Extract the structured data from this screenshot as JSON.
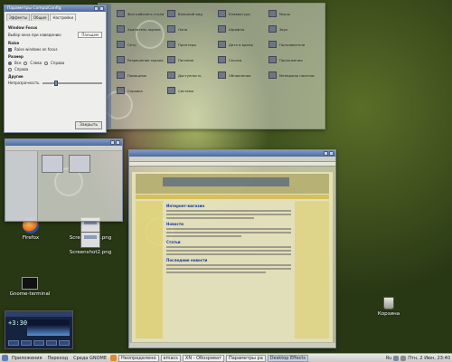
{
  "desktop_icons": {
    "firefox": "Firefox",
    "screenshot1": "Screenshot1.png",
    "screenshot2": "Screenshot2.png",
    "terminal": "Gnome-terminal",
    "trash": "Корзина"
  },
  "prefs_dialog": {
    "title": "Параметры CompizConfig",
    "tabs": [
      "Эффекты",
      "Общие",
      "Настройки"
    ],
    "section_window": "Window Focus",
    "focus_label": "Выбор окна при наведении:",
    "focus_value": "Пальцем",
    "section_raise": "Raise",
    "raise_opt": "Raise windows on focus",
    "section_size": "Размер",
    "size_opts": [
      "Все",
      "Слева",
      "Справа",
      "Справа"
    ],
    "section_other": "Другие",
    "opacity_label": "Непрозрачность",
    "close_label": "Закрыть"
  },
  "control_center": {
    "items": [
      "Фон рабочего стола",
      "Внешний вид",
      "Клавиатура",
      "Мышь",
      "Хранитель экрана",
      "Окна",
      "Шрифты",
      "Звук",
      "Сеть",
      "Принтеры",
      "Дата и время",
      "Пользователи",
      "Разрешение экрана",
      "Питание",
      "Сессии",
      "Приложения",
      "Помощник",
      "Доступность",
      "Обновления",
      "Менеджер пакетов",
      "Справка",
      "Система"
    ]
  },
  "browser": {
    "headline1": "Интернет-магазин",
    "headline2": "Новости",
    "headline3": "Статьи",
    "headline4": "Последние новости"
  },
  "media": {
    "time": "+3:30"
  },
  "taskbar": {
    "menu_apps": "Приложения",
    "menu_places": "Переход",
    "menu_system": "Среда GNOME",
    "buttons": [
      "Неопределено",
      "emacs",
      "XN - Обозреват",
      "Параметры ра",
      "Desktop Effects"
    ],
    "layout": "Ru",
    "clock": "Птн, 2 Июн, 23:40"
  },
  "colors": {
    "title_bar": "#4c6aa0",
    "taskbar": "#d8d8d4",
    "desktop": "#4b6226"
  }
}
